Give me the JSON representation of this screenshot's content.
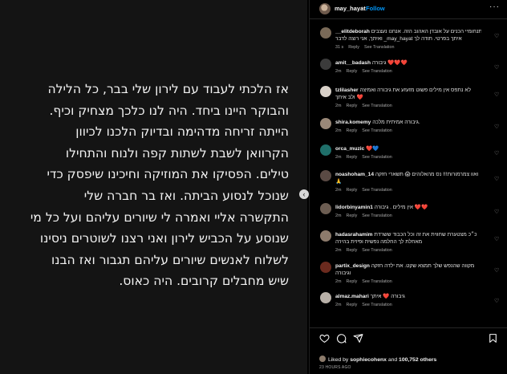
{
  "post": {
    "text": "אז הלכתי לעבוד עם לירון שלי בבר, כל הלילה\nוהבוקר היינו ביחד. היה לנו כלכך מצחיק וכיף.\nהייתה זריחה מדהימה ובדיוק הלכנו לכיוון\nהקרוואן לשבת לשתות קפה ולנוח והתחילו\nטילים. הפסיקו את המוזיקה וחיכינו שיפסק כדי\nשנוכל לנסוע הביתה. ואז בר חברה שלי\nהתקשרה אליי ואמרה לי שיורים עליהם ועל כל מי\nשנוסע על הכביש לירון ואני רצנו לשוטרים ניסינו\nלשלוח לאנשים שיורים עליהם תגבור ואז הבנו\nשיש מחבלים קרובים. היה כאוס."
  },
  "header": {
    "username": "may_hayat",
    "separator": "•",
    "follow_label": "Follow",
    "more_label": "···"
  },
  "comments": [
    {
      "username": "__elitdeborah",
      "text_line1": "תנחומיי הכנים על אובדן האהוב הזה. אנחנו נעצבים",
      "text_line2": "ואיתך, אני רוצה לדבר _may_hayat איתך בפרטי. תודה לך",
      "time": "31 s",
      "likes": "",
      "reply": "Reply",
      "translation": "See Translation",
      "avatar_color": "#7a6a58"
    },
    {
      "username": "amit__badash",
      "text_line1": "גיבורה ❤️❤️❤️",
      "text_line2": "",
      "time": "2m",
      "likes": "",
      "reply": "Reply",
      "translation": "See Translation",
      "avatar_color": "#3b3b3b"
    },
    {
      "username": "tzlilasher",
      "text_line1": "לא נתפס אין מילים פשוט מזעזע את גיבורה ואמיצה",
      "text_line2": "ולב איתך ❤️",
      "time": "2m",
      "likes": "",
      "reply": "Reply",
      "translation": "See Translation",
      "avatar_color": "#d8d0c8"
    },
    {
      "username": "shira.komemy",
      "text_line1": "גיבורה אמיתית מלכה.",
      "text_line2": "",
      "time": "2m",
      "likes": "",
      "reply": "Reply",
      "translation": "See Translation",
      "avatar_color": "#9a8878"
    },
    {
      "username": "orca_muzic",
      "text_line1": "❤️💙",
      "text_line2": "",
      "time": "2m",
      "likes": "",
      "reply": "Reply",
      "translation": "See Translation",
      "avatar_color": "#1f6f6a"
    },
    {
      "username": "noashoham_14",
      "text_line1": "ואוו צמרמורות!!! נס מהאלוהים 😱 תשארי חזקה",
      "text_line2": "🙏",
      "time": "2m",
      "likes": "",
      "reply": "Reply",
      "translation": "See Translation",
      "avatar_color": "#5a4a44"
    },
    {
      "username": "lidorbinyamin1",
      "text_line1": "אין מילים . גיבורה ❤️❤️",
      "text_line2": "",
      "time": "2m",
      "likes": "",
      "reply": "Reply",
      "translation": "See Translation",
      "avatar_color": "#6c5d52"
    },
    {
      "username": "hadasrahamim",
      "text_line1": "כ״כ מצטערת שחווית את זה וכל הכבוד ששרדת",
      "text_line2": "מאחלת לך החלמה נפשית ופיזית בהירה",
      "time": "2m",
      "likes": "",
      "reply": "Reply",
      "translation": "See Translation",
      "avatar_color": "#8d7b6c"
    },
    {
      "username": "partix_design",
      "text_line1": "מקווה שהנפש שלך תמצא שקט. את ילדה חזקה",
      "text_line2": "וגיבורה",
      "time": "2m",
      "likes": "",
      "reply": "Reply",
      "translation": "See Translation",
      "avatar_color": "#6b2a1e"
    },
    {
      "username": "almaz.mahari",
      "text_line1": "גיבורה ❤️ איתך",
      "text_line2": "",
      "time": "2m",
      "likes": "",
      "reply": "Reply",
      "translation": "See Translation",
      "avatar_color": "#b8b0a8"
    }
  ],
  "footer": {
    "liked_by_prefix": "Liked by",
    "liked_by_user": "sophiecohenx",
    "and_label": "and",
    "others_count": "100,752 others",
    "time": "23 HOURS AGO"
  },
  "icons": {
    "heart": "heart-icon",
    "comment": "comment-icon",
    "share": "share-icon",
    "save": "bookmark-icon",
    "prev": "chevron-left-icon"
  },
  "colors": {
    "accent": "#0095f6",
    "background": "#000000",
    "post_bg": "#141414"
  }
}
